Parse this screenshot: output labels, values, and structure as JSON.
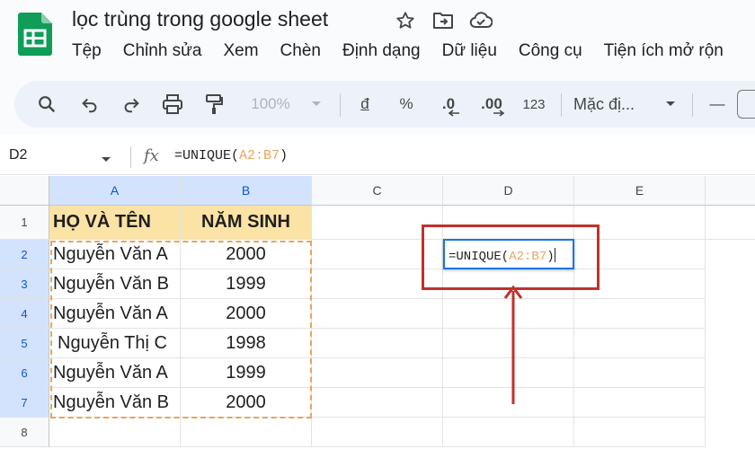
{
  "app": {
    "doc_title": "lọc trùng trong google sheet",
    "menu": [
      "Tệp",
      "Chỉnh sửa",
      "Xem",
      "Chèn",
      "Định dạng",
      "Dữ liệu",
      "Công cụ",
      "Tiện ích mở rộn"
    ]
  },
  "toolbar": {
    "zoom": "100%",
    "currency_symbol": "đ",
    "percent": "%",
    "decrease_decimals": ".0",
    "increase_decimals": ".00",
    "number_format": "123",
    "font_name": "Mặc đị...",
    "minus": "—"
  },
  "formula_bar": {
    "name_box": "D2",
    "fx": "fx",
    "formula_prefix": "=UNIQUE(",
    "formula_range": "A2:B7",
    "formula_suffix": ")"
  },
  "sheet": {
    "columns": [
      "A",
      "B",
      "C",
      "D",
      "E"
    ],
    "rows": [
      "1",
      "2",
      "3",
      "4",
      "5",
      "6",
      "7",
      "8"
    ],
    "header": {
      "a": "HỌ VÀ TÊN",
      "b": "NĂM SINH"
    },
    "data": [
      {
        "name": "Nguyễn Văn A",
        "year": "2000"
      },
      {
        "name": "Nguyễn Văn B",
        "year": "1999"
      },
      {
        "name": "Nguyễn Văn A",
        "year": "2000"
      },
      {
        "name": "Nguyễn Thị C",
        "year": "1998"
      },
      {
        "name": "Nguyễn Văn A",
        "year": "1999"
      },
      {
        "name": "Nguyễn Văn B",
        "year": "2000"
      }
    ],
    "active_cell": {
      "prefix": "=UNIQUE(",
      "range": "A2:B7",
      "suffix": ")"
    }
  },
  "colors": {
    "accent_blue": "#1a73e8",
    "header_fill": "#fbe3a5",
    "range_orange": "#e9a45b",
    "callout_red": "#c0312b"
  }
}
